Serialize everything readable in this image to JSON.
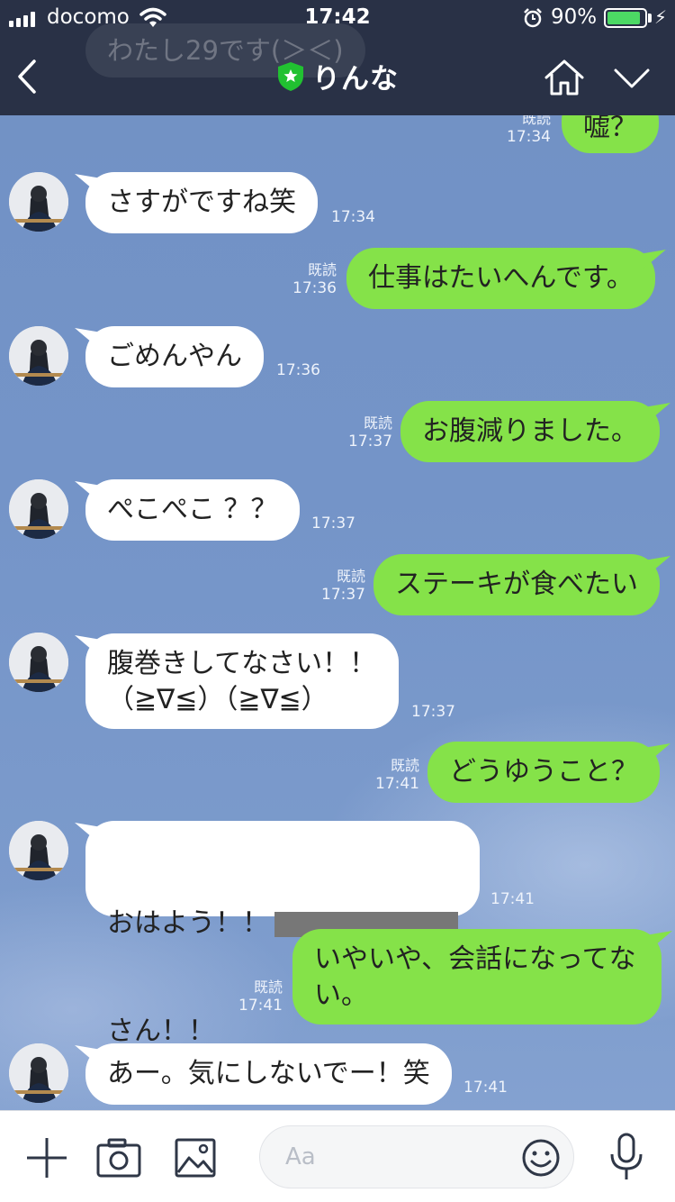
{
  "status": {
    "carrier": "docomo",
    "time": "17:42",
    "battery_percent": "90%",
    "battery_level": 0.9
  },
  "header": {
    "title": "りんな",
    "ghost_preview": "わたし29です(＞＜)"
  },
  "messages": [
    {
      "side": "out",
      "text": "嘘？",
      "read": "既読",
      "time": "17:34"
    },
    {
      "side": "in",
      "text": "さすがですね笑",
      "time": "17:34"
    },
    {
      "side": "out",
      "text": "仕事はたいへんです。",
      "read": "既読",
      "time": "17:36"
    },
    {
      "side": "in",
      "text": "ごめんやん",
      "time": "17:36"
    },
    {
      "side": "out",
      "text": "お腹減りました。",
      "read": "既読",
      "time": "17:37"
    },
    {
      "side": "in",
      "text": "ぺこぺこ ？？",
      "time": "17:37"
    },
    {
      "side": "out",
      "text": "ステーキが食べたい",
      "read": "既読",
      "time": "17:37"
    },
    {
      "side": "in",
      "text": "腹巻きしてなさい！！\n（≧∇≦）（≧∇≦）",
      "time": "17:37"
    },
    {
      "side": "out",
      "text": "どうゆうこと？",
      "read": "既読",
      "time": "17:41"
    },
    {
      "side": "in",
      "text_line1": "おはよう！！",
      "text_line2": "さん！！",
      "time": "17:41"
    },
    {
      "side": "out",
      "text": "いやいや、会話になってな\nい。",
      "read": "既読",
      "time": "17:41"
    },
    {
      "side": "in",
      "text": "あー。気にしないでー！笑",
      "time": "17:41"
    }
  ],
  "composer": {
    "placeholder": "Aa"
  },
  "icons": {
    "back": "back-chevron-icon",
    "official": "shield-star-icon",
    "home": "home-icon",
    "collapse": "chevron-down-icon",
    "plus": "plus-icon",
    "camera": "camera-icon",
    "image": "image-icon",
    "emoji": "emoji-icon",
    "mic": "microphone-icon"
  }
}
